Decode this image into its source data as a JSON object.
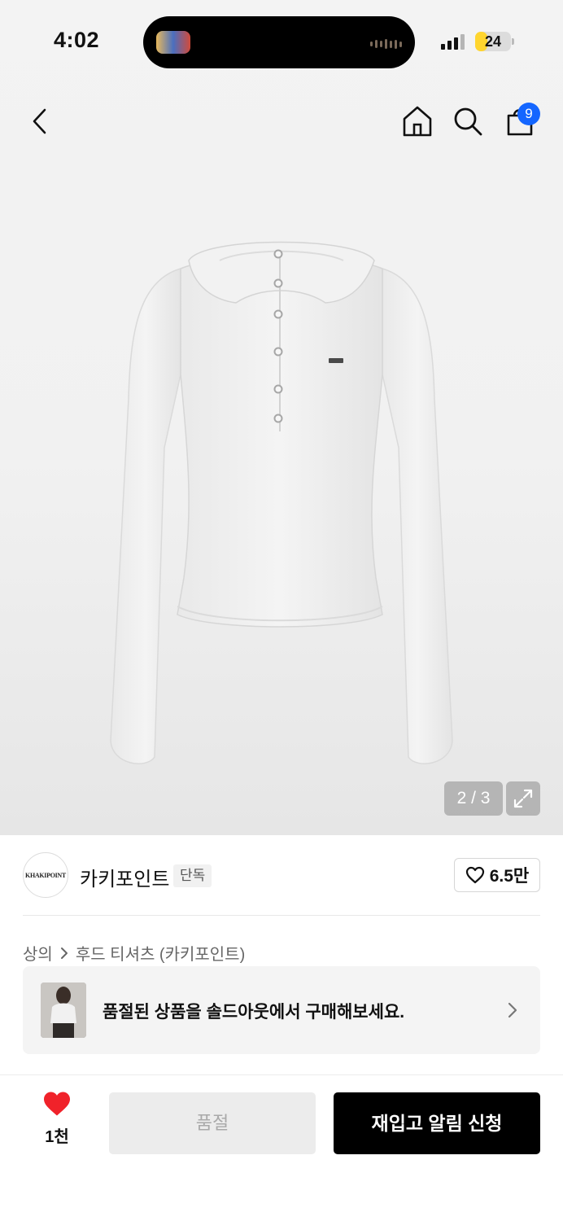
{
  "status_bar": {
    "time": "4:02",
    "battery": "24",
    "battery_level": 0.24
  },
  "nav": {
    "back_icon": "chevron-left-icon",
    "home_icon": "home-icon",
    "search_icon": "search-icon",
    "cart_icon": "shopping-bag-icon",
    "cart_badge": "9"
  },
  "gallery": {
    "counter": "2 / 3",
    "current_index": 2,
    "total": 3,
    "expand_icon": "expand-icon"
  },
  "brand": {
    "logo_text": "KHAKIPOINT",
    "name": "카키포인트",
    "tag": "단독",
    "like_count": "6.5만"
  },
  "breadcrumb": {
    "category": "상의",
    "subcategory": "후드 티셔츠 (카키포인트)"
  },
  "soldout_banner": {
    "text": "품절된 상품을 솔드아웃에서 구매해보세요."
  },
  "bottom_bar": {
    "like_count": "1천",
    "soldout_label": "품절",
    "restock_label": "재입고 알림 신청"
  },
  "colors": {
    "badge": "#1466ff",
    "heart": "#f0222a",
    "primary_button": "#000000",
    "disabled_button": "#ececec"
  }
}
